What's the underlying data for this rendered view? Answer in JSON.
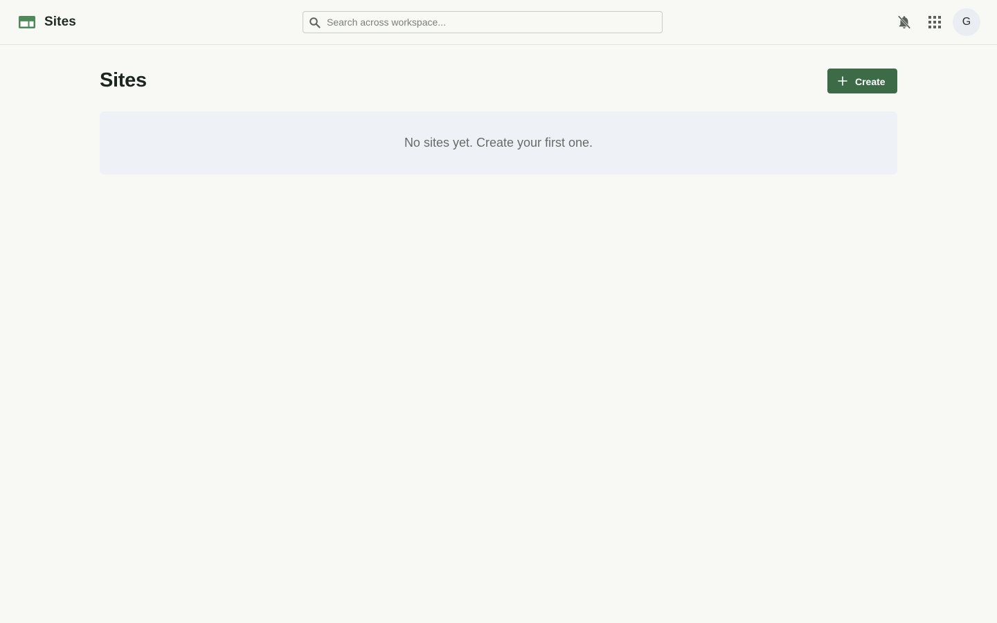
{
  "header": {
    "app_name": "Sites",
    "app_icon": "sites-icon",
    "brand_color": "#4c8a5a",
    "search": {
      "placeholder": "Search across workspace...",
      "value": "",
      "icon": "search-icon"
    },
    "notifications_icon": "bell-off-icon",
    "apps_icon": "apps-grid-icon",
    "avatar_initial": "G"
  },
  "main": {
    "title": "Sites",
    "create_button": {
      "label": "Create",
      "icon": "plus-icon",
      "color": "#3d6b48"
    },
    "empty_state": {
      "message": "No sites yet. Create your first one."
    }
  }
}
